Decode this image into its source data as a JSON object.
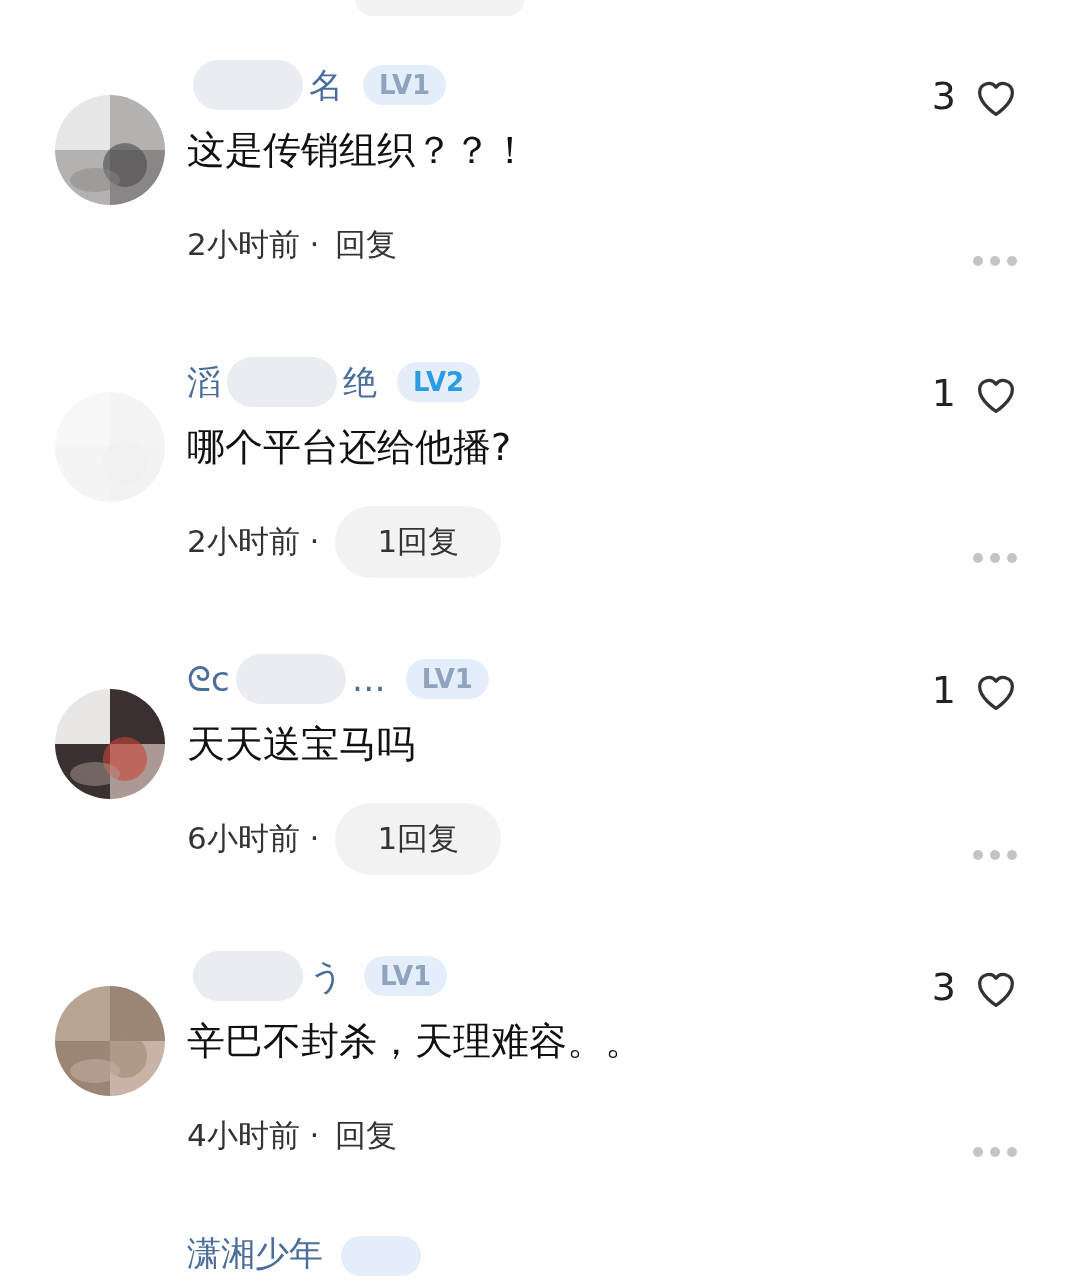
{
  "comments": [
    {
      "avatar": {
        "kind": "picture"
      },
      "name_segments": [
        {
          "kind": "masked"
        },
        {
          "kind": "text",
          "text": "名"
        }
      ],
      "badge": {
        "text": "LV1",
        "color": "#8fa3bd"
      },
      "text": "这是传销组织？？！",
      "likes": "3",
      "time": "2小时前 ·",
      "reply": {
        "kind": "link",
        "text": "回复"
      }
    },
    {
      "avatar": {
        "kind": "picture"
      },
      "name_segments": [
        {
          "kind": "text",
          "text": "滔"
        },
        {
          "kind": "masked"
        },
        {
          "kind": "text",
          "text": "绝"
        }
      ],
      "badge": {
        "text": "LV2",
        "color": "#2b9be3"
      },
      "text": "哪个平台还给他播?",
      "likes": "1",
      "time": "2小时前 ·",
      "reply": {
        "kind": "pill",
        "text": "1回复"
      }
    },
    {
      "avatar": {
        "kind": "picture"
      },
      "name_segments": [
        {
          "kind": "text",
          "text": "ᘓc"
        },
        {
          "kind": "masked"
        },
        {
          "kind": "text",
          "text": "…"
        }
      ],
      "badge": {
        "text": "LV1",
        "color": "#8fa3bd"
      },
      "text": "天天送宝马吗",
      "likes": "1",
      "time": "6小时前 ·",
      "reply": {
        "kind": "pill",
        "text": "1回复"
      }
    },
    {
      "avatar": {
        "kind": "picture"
      },
      "name_segments": [
        {
          "kind": "masked"
        },
        {
          "kind": "text",
          "text": "う"
        }
      ],
      "badge": {
        "text": "LV1",
        "color": "#8fa3bd"
      },
      "text": "辛巴不封杀，天理难容。。",
      "likes": "3",
      "time": "4小时前 ·",
      "reply": {
        "kind": "link",
        "text": "回复"
      }
    }
  ],
  "next_comment": {
    "name": "潇湘少年"
  }
}
